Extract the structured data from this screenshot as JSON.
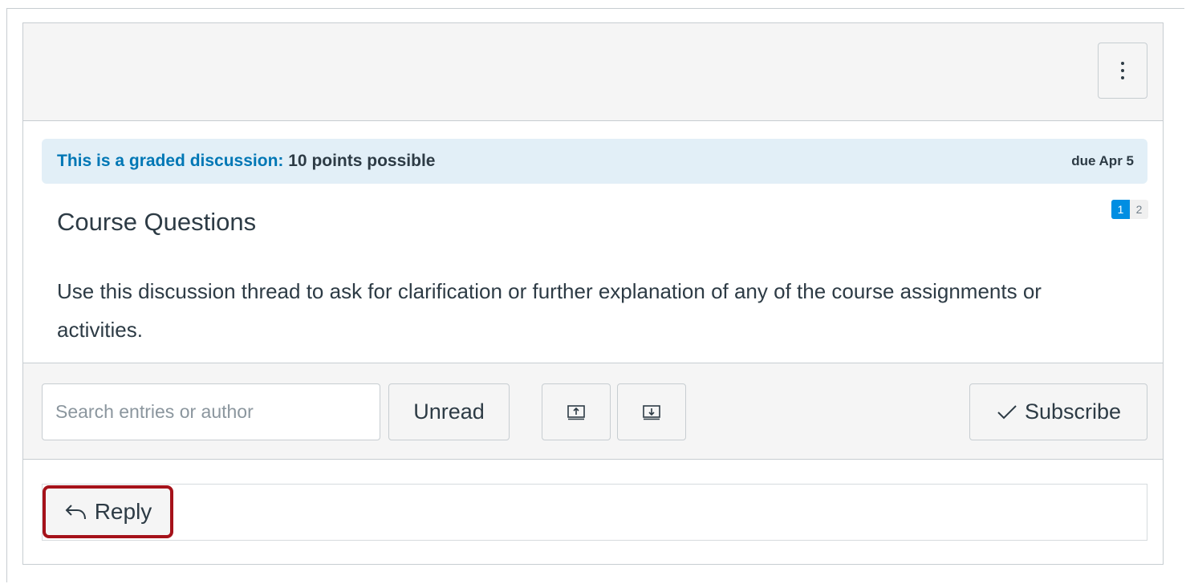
{
  "discussion": {
    "graded_label": "This is a graded discussion:",
    "points": "10 points possible",
    "due": "due Apr 5",
    "title": "Course Questions",
    "pages": [
      "1",
      "2"
    ],
    "body": "Use this discussion thread to ask for clarification or further explanation of any of the course assignments or activities."
  },
  "toolbar": {
    "search_placeholder": "Search entries or author",
    "unread_label": "Unread",
    "subscribe_label": "Subscribe",
    "subscribe_icon": "checkmark-icon",
    "collapse_icon": "collapse-threads-icon",
    "expand_icon": "expand-threads-icon"
  },
  "reply": {
    "label": "Reply",
    "icon": "reply-arrow-icon",
    "highlight_color": "#a5121a"
  },
  "colors": {
    "accent": "#008ee2",
    "link": "#0077b5",
    "graded_bg": "#e2eff7"
  }
}
